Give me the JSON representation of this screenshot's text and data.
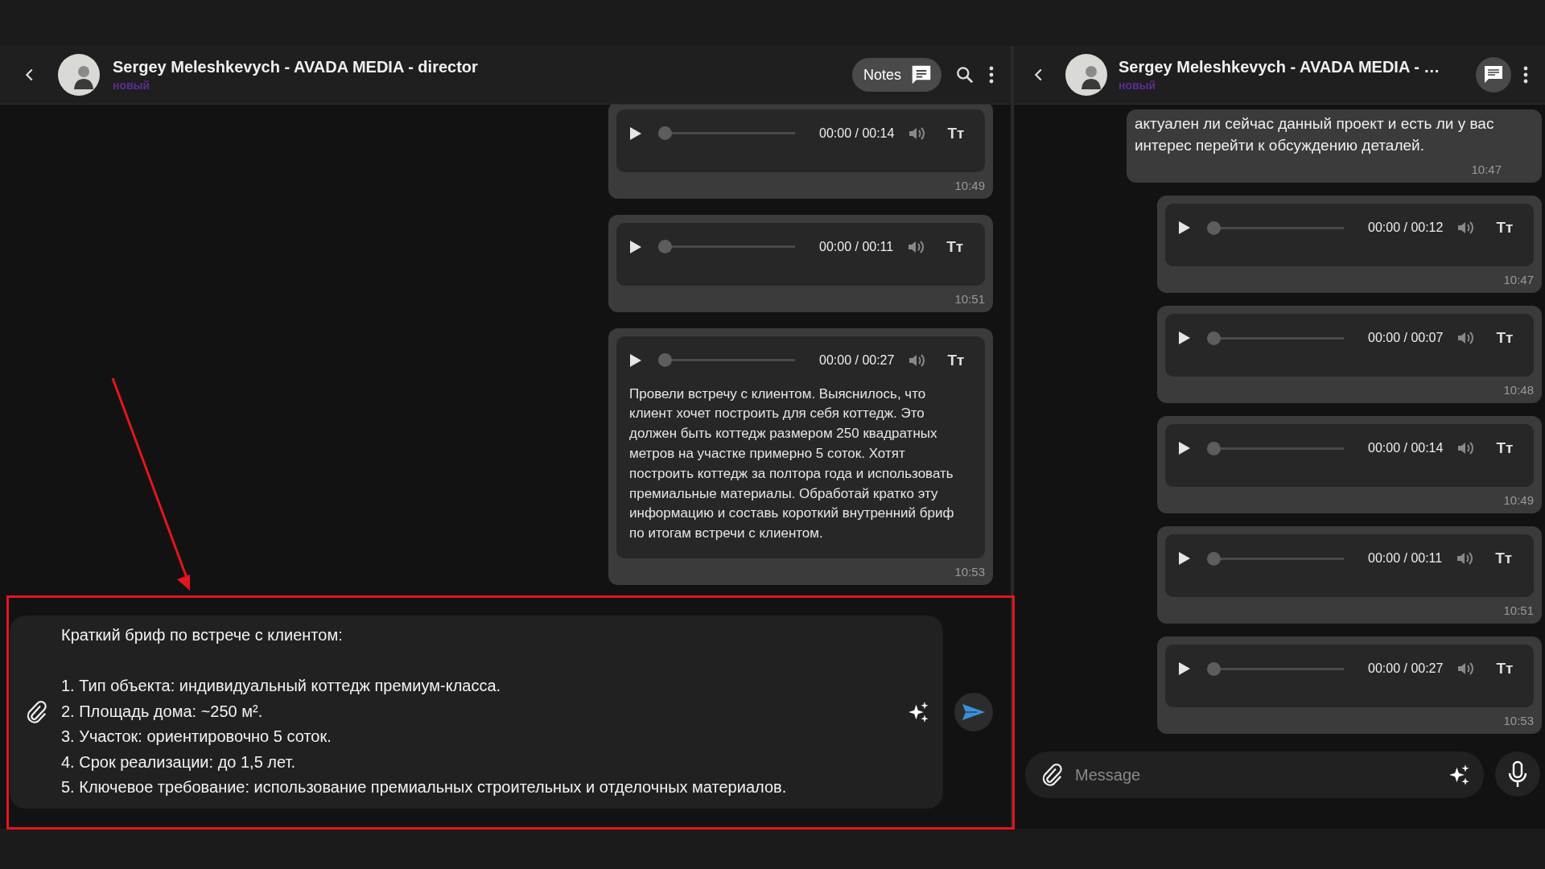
{
  "left_chat": {
    "header": {
      "title": "Sergey Meleshkevych - AVADA MEDIA - director",
      "status": "новый",
      "notes_button": "Notes"
    },
    "messages": [
      {
        "kind": "voice",
        "time_code": "00:00 / 00:14",
        "level": 0,
        "transcribe_button": "Tт",
        "time": "10:49"
      },
      {
        "kind": "voice",
        "time_code": "00:00 / 00:11",
        "level": 0,
        "transcribe_button": "Tт",
        "time": "10:51"
      },
      {
        "kind": "voice",
        "time_code": "00:00 / 00:27",
        "level": 0,
        "transcribe_button": "Tт",
        "transcript": "Провели встречу с клиентом. Выяснилось, что клиент хочет построить для себя коттедж. Это должен быть коттедж размером 250 квадратных метров на участке примерно 5 соток. Хотят построить коттедж за полтора года и использовать премиальные материалы. Обработай кратко эту информацию и составь короткий внутренний бриф по итогам встречи с клиентом.",
        "time": "10:53"
      }
    ],
    "composer": {
      "value": "Краткий бриф по встрече с клиентом:\n\n1. Тип объекта: индивидуальный коттедж премиум-класса.\n2. Площадь дома: ~250 м².\n3. Участок: ориентировочно 5 соток.\n4. Срок реализации: до 1,5 лет.\n5. Ключевое требование: использование премиальных строительных и отделочных материалов."
    }
  },
  "right_chat": {
    "header": {
      "title": "Sergey Meleshkevych - AVADA MEDIA - …",
      "status": "новый"
    },
    "messages": [
      {
        "kind": "text",
        "text": "актуален ли сейчас данный проект и есть ли у вас интерес перейти к обсуждению деталей.",
        "time": "10:47"
      },
      {
        "kind": "voice",
        "time_code": "00:00 / 00:12",
        "level": 0,
        "transcribe_button": "Tт",
        "time": "10:47"
      },
      {
        "kind": "voice",
        "time_code": "00:00 / 00:07",
        "level": 0,
        "transcribe_button": "Tт",
        "time": "10:48"
      },
      {
        "kind": "voice",
        "time_code": "00:00 / 00:14",
        "level": 0,
        "transcribe_button": "Tт",
        "time": "10:49"
      },
      {
        "kind": "voice",
        "time_code": "00:00 / 00:11",
        "level": 0,
        "transcribe_button": "Tт",
        "time": "10:51"
      },
      {
        "kind": "voice",
        "time_code": "00:00 / 00:27",
        "level": 0,
        "transcribe_button": "Tт",
        "time": "10:53"
      }
    ],
    "composer": {
      "placeholder": "Message"
    }
  }
}
